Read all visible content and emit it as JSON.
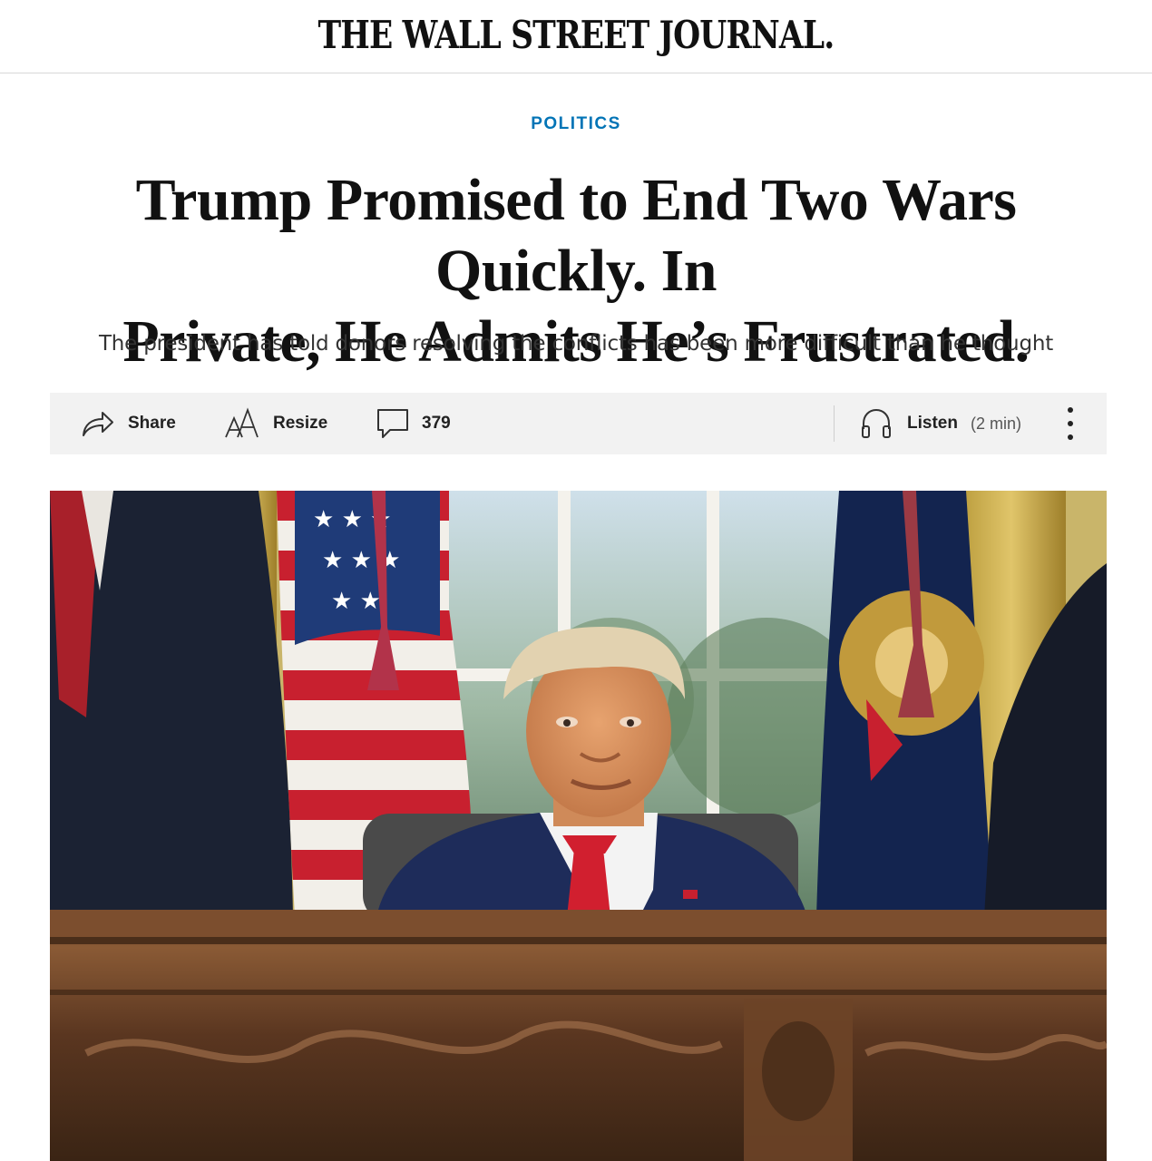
{
  "masthead": {
    "title": "THE WALL STREET JOURNAL."
  },
  "article": {
    "section": "POLITICS",
    "headline_line1": "Trump Promised to End Two Wars Quickly. In",
    "headline_line2": "Private, He Admits He’s Frustrated.",
    "dek": "The president has told donors resolving the conflicts has been more difficult than he thought"
  },
  "toolbar": {
    "share_label": "Share",
    "resize_label": "Resize",
    "comments_count": "379",
    "listen_label": "Listen",
    "listen_duration": "(2 min)",
    "icons": [
      "share-icon",
      "resize-icon",
      "comment-icon",
      "headphones-icon",
      "more-options-icon"
    ]
  },
  "colors": {
    "section_accent": "#0274b6",
    "toolbar_bg": "#f2f2f2",
    "text": "#111111"
  }
}
